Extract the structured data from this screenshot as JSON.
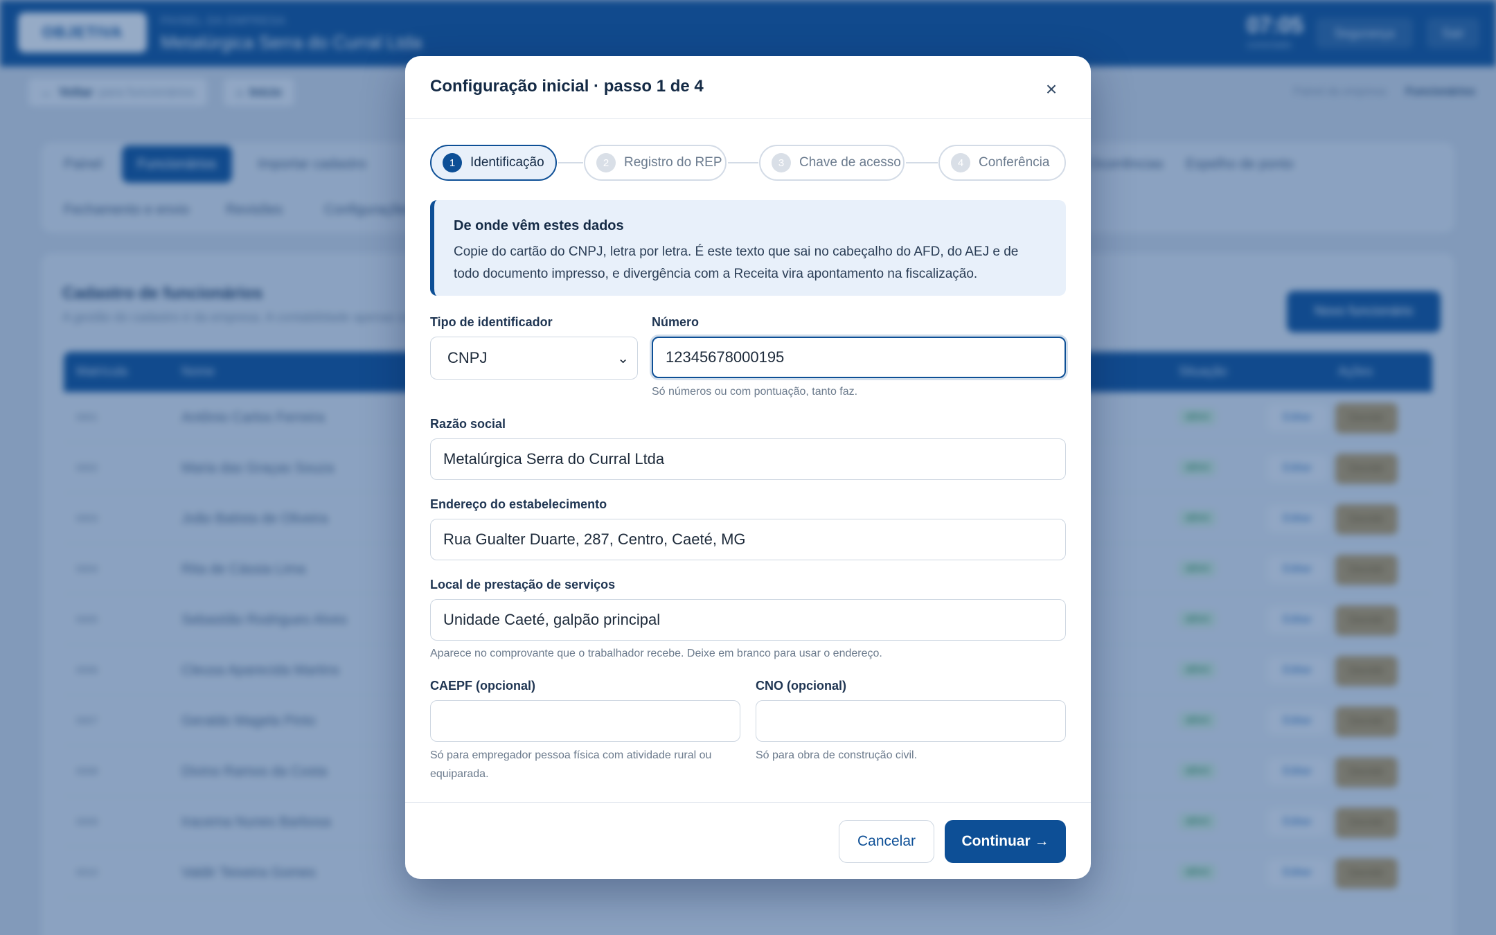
{
  "background": {
    "logo_text": "OBJETIVA",
    "kicker": "PAINEL DA EMPRESA",
    "company": "Metalúrgica Serra do Curral Ltda",
    "clock": "07:05",
    "clock_sub": "conectado",
    "security_label": "Segurança",
    "exit_label": "Sair",
    "back_label": "Voltar",
    "back_sub": "para funcionários",
    "home_label": "Início",
    "breadcrumb_parent": "Painel da empresa",
    "breadcrumb_current": "Funcionários",
    "tabs_row1": [
      "Painel",
      "Funcionários",
      "Importar cadastro",
      "Ocorrências",
      "Espelho de ponto"
    ],
    "tabs_row2": [
      "Fechamento e envio",
      "Revisões",
      "Configurações"
    ],
    "section_title": "Cadastro de funcionários",
    "section_sub": "A gestão do cadastro é da empresa. A contabilidade apenas consulta.",
    "new_button": "Novo funcionário",
    "table_headers": [
      "Matrícula",
      "Nome",
      "Situação",
      "Ações"
    ],
    "rows": [
      {
        "mat": "0001",
        "name": "Antônio Carlos Ferreira",
        "status": "ativo"
      },
      {
        "mat": "0002",
        "name": "Maria das Graças Souza",
        "status": "ativo"
      },
      {
        "mat": "0003",
        "name": "João Batista de Oliveira",
        "status": "ativo"
      },
      {
        "mat": "0004",
        "name": "Rita de Cássia Lima",
        "status": "ativo"
      },
      {
        "mat": "0005",
        "name": "Sebastião Rodrigues Alves",
        "status": "ativo"
      },
      {
        "mat": "0006",
        "name": "Cleusa Aparecida Martins",
        "status": "ativo"
      },
      {
        "mat": "0007",
        "name": "Geraldo Magela Pinto",
        "status": "ativo"
      },
      {
        "mat": "0008",
        "name": "Divino Ramos da Costa",
        "status": "ativo"
      },
      {
        "mat": "0009",
        "name": "Iracema Nunes Barbosa",
        "status": "ativo"
      },
      {
        "mat": "0010",
        "name": "Valdir Teixeira Gomes",
        "status": "ativo"
      }
    ],
    "edit_label": "Editar",
    "dismiss_label": "Demitir"
  },
  "modal": {
    "title": "Configuração inicial · passo 1 de 4",
    "close_glyph": "×",
    "steps": [
      {
        "num": "1",
        "label": "Identificação"
      },
      {
        "num": "2",
        "label": "Registro do REP"
      },
      {
        "num": "3",
        "label": "Chave de acesso"
      },
      {
        "num": "4",
        "label": "Conferência"
      }
    ],
    "info_title": "De onde vêm estes dados",
    "info_text": "Copie do cartão do CNPJ, letra por letra. É este texto que sai no cabeçalho do AFD, do AEJ e de todo documento impresso, e divergência com a Receita vira apontamento na fiscalização.",
    "id_type_label": "Tipo de identificador",
    "id_type_value": "CNPJ",
    "number_label": "Número",
    "number_value": "12345678000195",
    "number_hint": "Só números ou com pontuação, tanto faz.",
    "company_name_label": "Razão social",
    "company_name_value": "Metalúrgica Serra do Curral Ltda",
    "address_label": "Endereço do estabelecimento",
    "address_value": "Rua Gualter Duarte, 287, Centro, Caeté, MG",
    "service_place_label": "Local de prestação de serviços",
    "service_place_value": "Unidade Caeté, galpão principal",
    "service_place_hint": "Aparece no comprovante que o trabalhador recebe. Deixe em branco para usar o endereço.",
    "caepf_label": "CAEPF (opcional)",
    "caepf_value": "",
    "caepf_hint": "Só para empregador pessoa física com atividade rural ou equiparada.",
    "cno_label": "CNO (opcional)",
    "cno_value": "",
    "cno_hint": "Só para obra de construção civil.",
    "cancel_label": "Cancelar",
    "continue_label": "Continuar →"
  }
}
